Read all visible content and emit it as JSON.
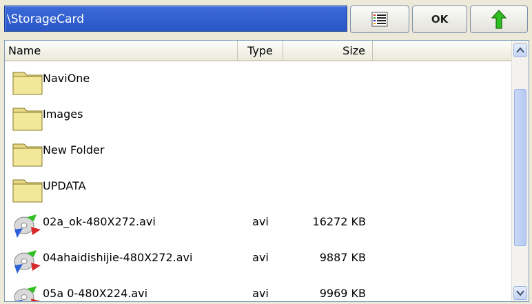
{
  "path": {
    "value": "\\StorageCard"
  },
  "toolbar": {
    "view_icon": "list-view-icon",
    "ok_label": "OK",
    "up_icon": "up-arrow-icon"
  },
  "columns": {
    "name": "Name",
    "type": "Type",
    "size": "Size"
  },
  "rows": [
    {
      "name": "NaviOne",
      "type": "",
      "size": "",
      "icon": "folder-icon"
    },
    {
      "name": "Images",
      "type": "",
      "size": "",
      "icon": "folder-icon"
    },
    {
      "name": "New Folder",
      "type": "",
      "size": "",
      "icon": "folder-icon"
    },
    {
      "name": "UPDATA",
      "type": "",
      "size": "",
      "icon": "folder-icon"
    },
    {
      "name": "02a_ok-480X272.avi",
      "type": "avi",
      "size": "16272 KB",
      "icon": "video-file-icon"
    },
    {
      "name": "04ahaidishijie-480X272.avi",
      "type": "avi",
      "size": "9887 KB",
      "icon": "video-file-icon"
    },
    {
      "name": "05a 0-480X224.avi",
      "type": "avi",
      "size": "9969 KB",
      "icon": "video-file-icon"
    }
  ],
  "scrollbar": {
    "up_icon": "scroll-up-icon",
    "down_icon": "scroll-down-icon"
  }
}
